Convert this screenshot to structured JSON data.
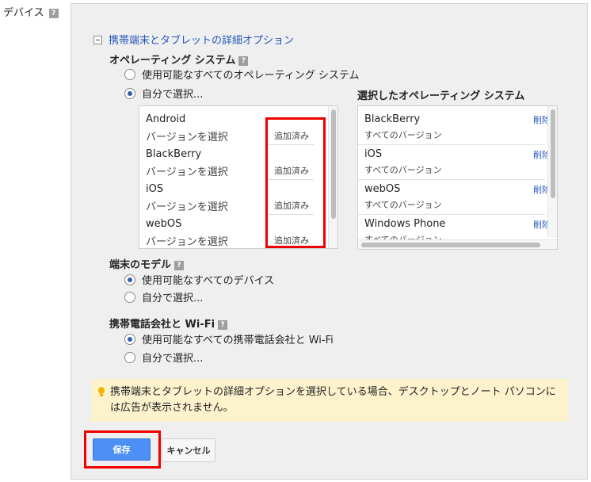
{
  "device_label": "デバイス",
  "help_glyph": "?",
  "advanced_header": "携帯端末とタブレットの詳細オプション",
  "os_section": {
    "title": "オペレーティング システム",
    "radio_all": "使用可能なすべてのオペレーティング システム",
    "radio_custom": "自分で選択...",
    "selected_option": "custom"
  },
  "os_list": [
    {
      "name": "Android",
      "version": "バージョンを選択",
      "status": "追加済み"
    },
    {
      "name": "BlackBerry",
      "version": "バージョンを選択",
      "status": "追加済み"
    },
    {
      "name": "iOS",
      "version": "バージョンを選択",
      "status": "追加済み"
    },
    {
      "name": "webOS",
      "version": "バージョンを選択",
      "status": "追加済み"
    }
  ],
  "selected_os": {
    "title": "選択したオペレーティング システム",
    "items": [
      {
        "name": "BlackBerry",
        "version": "すべてのバージョン",
        "remove": "削除"
      },
      {
        "name": "iOS",
        "version": "すべてのバージョン",
        "remove": "削除"
      },
      {
        "name": "webOS",
        "version": "すべてのバージョン",
        "remove": "削除"
      },
      {
        "name": "Windows Phone",
        "version": "すべてのバージョン",
        "remove": "削除"
      }
    ]
  },
  "device_model": {
    "title": "端末のモデル",
    "radio_all": "使用可能なすべてのデバイス",
    "radio_custom": "自分で選択...",
    "selected_option": "all"
  },
  "carrier": {
    "title": "携帯電話会社と Wi-Fi",
    "radio_all": "使用可能なすべての携帯電話会社と Wi-Fi",
    "radio_custom": "自分で選択...",
    "selected_option": "all"
  },
  "notice": {
    "icon": "lightbulb-icon",
    "text": "携帯端末とタブレットの詳細オプションを選択している場合、デスクトップとノート パソコンには広告が表示されません。"
  },
  "buttons": {
    "save": "保存",
    "cancel": "キャンセル"
  },
  "colors": {
    "accent_blue": "#4d8ff4",
    "link_blue": "#2255bb",
    "highlight_red": "#ee0000",
    "notice_bg": "#fcf3cd",
    "panel_bg": "#efefef"
  }
}
